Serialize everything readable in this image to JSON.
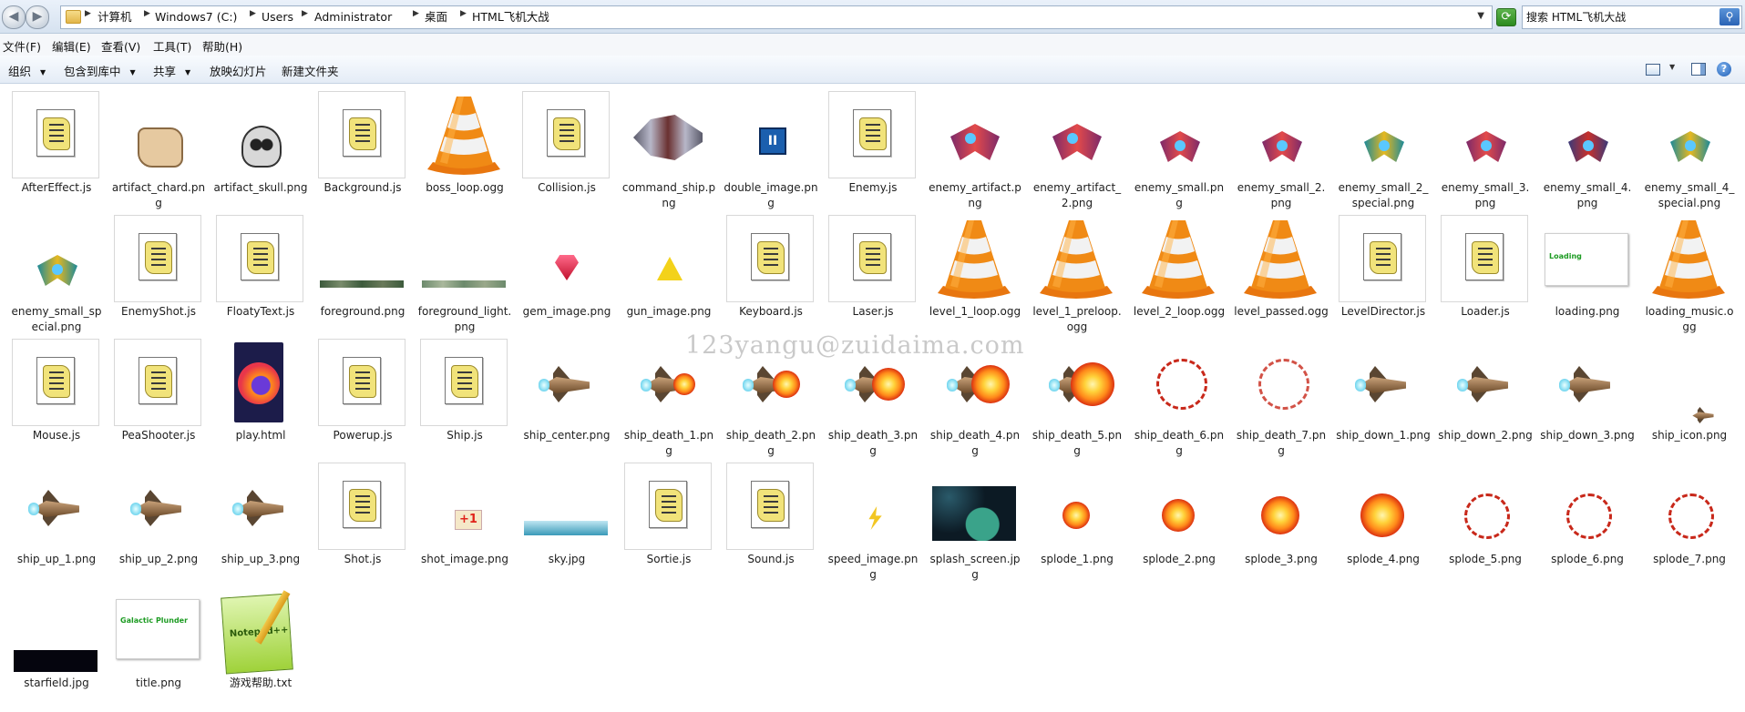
{
  "nav": {
    "back": "◀",
    "forward": "▶",
    "refresh": "⟳",
    "search_glyph": "⚲"
  },
  "breadcrumbs": [
    "计算机",
    "Windows7 (C:)",
    "Users",
    "Administrator",
    "桌面",
    "HTML飞机大战"
  ],
  "search": {
    "value": "搜索 HTML飞机大战"
  },
  "menu": [
    "文件(F)",
    "编辑(E)",
    "查看(V)",
    "工具(T)",
    "帮助(H)"
  ],
  "toolbar": {
    "organize": "组织",
    "include_in_library": "包含到库中",
    "share": "共享",
    "slideshow": "放映幻灯片",
    "new_folder": "新建文件夹",
    "help": "?"
  },
  "watermark": "123yangu@zuidaima.com",
  "files": [
    {
      "name": "AfterEffect.js",
      "icon": "js-script-icon"
    },
    {
      "name": "artifact_chard.png",
      "icon": "image-thumbnail"
    },
    {
      "name": "artifact_skull.png",
      "icon": "image-thumbnail"
    },
    {
      "name": "Background.js",
      "icon": "js-script-icon"
    },
    {
      "name": "boss_loop.ogg",
      "icon": "vlc-cone-icon"
    },
    {
      "name": "Collision.js",
      "icon": "js-script-icon"
    },
    {
      "name": "command_ship.png",
      "icon": "image-thumbnail"
    },
    {
      "name": "double_image.png",
      "icon": "image-thumbnail"
    },
    {
      "name": "Enemy.js",
      "icon": "js-script-icon"
    },
    {
      "name": "enemy_artifact.png",
      "icon": "image-thumbnail"
    },
    {
      "name": "enemy_artifact_2.png",
      "icon": "image-thumbnail"
    },
    {
      "name": "enemy_small.png",
      "icon": "image-thumbnail"
    },
    {
      "name": "enemy_small_2.png",
      "icon": "image-thumbnail"
    },
    {
      "name": "enemy_small_2_special.png",
      "icon": "image-thumbnail"
    },
    {
      "name": "enemy_small_3.png",
      "icon": "image-thumbnail"
    },
    {
      "name": "enemy_small_4.png",
      "icon": "image-thumbnail"
    },
    {
      "name": "enemy_small_4_special.png",
      "icon": "image-thumbnail"
    },
    {
      "name": "enemy_small_special.png",
      "icon": "image-thumbnail"
    },
    {
      "name": "EnemyShot.js",
      "icon": "js-script-icon"
    },
    {
      "name": "FloatyText.js",
      "icon": "js-script-icon"
    },
    {
      "name": "foreground.png",
      "icon": "image-thumbnail"
    },
    {
      "name": "foreground_light.png",
      "icon": "image-thumbnail"
    },
    {
      "name": "gem_image.png",
      "icon": "image-thumbnail"
    },
    {
      "name": "gun_image.png",
      "icon": "image-thumbnail"
    },
    {
      "name": "Keyboard.js",
      "icon": "js-script-icon"
    },
    {
      "name": "Laser.js",
      "icon": "js-script-icon"
    },
    {
      "name": "level_1_loop.ogg",
      "icon": "vlc-cone-icon"
    },
    {
      "name": "level_1_preloop.ogg",
      "icon": "vlc-cone-icon"
    },
    {
      "name": "level_2_loop.ogg",
      "icon": "vlc-cone-icon"
    },
    {
      "name": "level_passed.ogg",
      "icon": "vlc-cone-icon"
    },
    {
      "name": "LevelDirector.js",
      "icon": "js-script-icon"
    },
    {
      "name": "Loader.js",
      "icon": "js-script-icon"
    },
    {
      "name": "loading.png",
      "icon": "image-thumbnail",
      "thumb_text": "Loading"
    },
    {
      "name": "loading_music.ogg",
      "icon": "vlc-cone-icon"
    },
    {
      "name": "Mouse.js",
      "icon": "js-script-icon"
    },
    {
      "name": "PeaShooter.js",
      "icon": "js-script-icon"
    },
    {
      "name": "play.html",
      "icon": "firefox-html-icon"
    },
    {
      "name": "Powerup.js",
      "icon": "js-script-icon"
    },
    {
      "name": "Ship.js",
      "icon": "js-script-icon"
    },
    {
      "name": "ship_center.png",
      "icon": "image-thumbnail"
    },
    {
      "name": "ship_death_1.png",
      "icon": "image-thumbnail"
    },
    {
      "name": "ship_death_2.png",
      "icon": "image-thumbnail"
    },
    {
      "name": "ship_death_3.png",
      "icon": "image-thumbnail"
    },
    {
      "name": "ship_death_4.png",
      "icon": "image-thumbnail"
    },
    {
      "name": "ship_death_5.png",
      "icon": "image-thumbnail"
    },
    {
      "name": "ship_death_6.png",
      "icon": "image-thumbnail"
    },
    {
      "name": "ship_death_7.png",
      "icon": "image-thumbnail"
    },
    {
      "name": "ship_down_1.png",
      "icon": "image-thumbnail"
    },
    {
      "name": "ship_down_2.png",
      "icon": "image-thumbnail"
    },
    {
      "name": "ship_down_3.png",
      "icon": "image-thumbnail"
    },
    {
      "name": "ship_icon.png",
      "icon": "image-thumbnail"
    },
    {
      "name": "ship_up_1.png",
      "icon": "image-thumbnail"
    },
    {
      "name": "ship_up_2.png",
      "icon": "image-thumbnail"
    },
    {
      "name": "ship_up_3.png",
      "icon": "image-thumbnail"
    },
    {
      "name": "Shot.js",
      "icon": "js-script-icon"
    },
    {
      "name": "shot_image.png",
      "icon": "image-thumbnail",
      "thumb_text": "+1"
    },
    {
      "name": "sky.jpg",
      "icon": "image-thumbnail"
    },
    {
      "name": "Sortie.js",
      "icon": "js-script-icon"
    },
    {
      "name": "Sound.js",
      "icon": "js-script-icon"
    },
    {
      "name": "speed_image.png",
      "icon": "image-thumbnail"
    },
    {
      "name": "splash_screen.jpg",
      "icon": "image-thumbnail"
    },
    {
      "name": "splode_1.png",
      "icon": "image-thumbnail"
    },
    {
      "name": "splode_2.png",
      "icon": "image-thumbnail"
    },
    {
      "name": "splode_3.png",
      "icon": "image-thumbnail"
    },
    {
      "name": "splode_4.png",
      "icon": "image-thumbnail"
    },
    {
      "name": "splode_5.png",
      "icon": "image-thumbnail"
    },
    {
      "name": "splode_6.png",
      "icon": "image-thumbnail"
    },
    {
      "name": "splode_7.png",
      "icon": "image-thumbnail"
    },
    {
      "name": "starfield.jpg",
      "icon": "image-thumbnail"
    },
    {
      "name": "title.png",
      "icon": "image-thumbnail",
      "thumb_text": "Galactic Plunder"
    },
    {
      "name": "游戏帮助.txt",
      "icon": "notepad-txt-icon",
      "thumb_text": "Notepad++"
    }
  ]
}
